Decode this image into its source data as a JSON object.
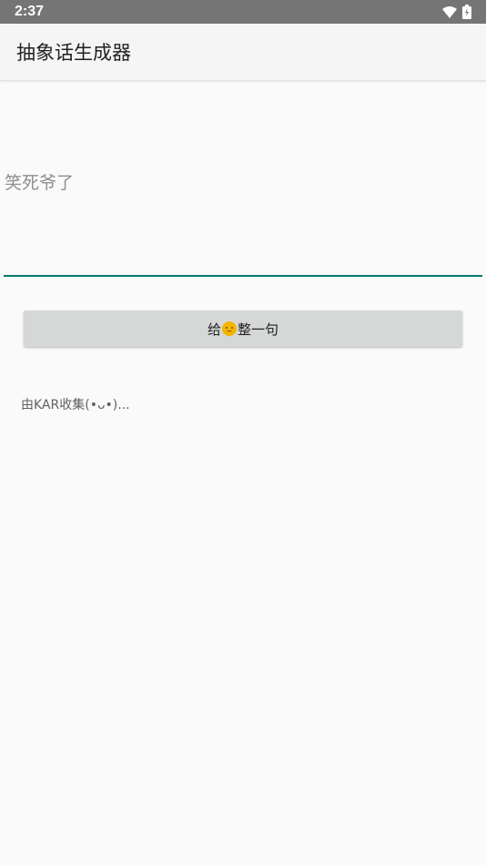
{
  "status_bar": {
    "time": "2:37",
    "icons": [
      "wifi-icon",
      "battery-icon"
    ]
  },
  "app_bar": {
    "title": "抽象话生成器"
  },
  "input": {
    "text": "笑死爷了",
    "underline_color": "#00796b"
  },
  "button": {
    "label_before": "给",
    "emoji_icon": "frowning-face-emoji",
    "label_after": "整一句"
  },
  "credit": {
    "text": "由KAR收集(•ᴗ•)..."
  },
  "colors": {
    "status_bar": "#757575",
    "app_bar": "#f5f5f5",
    "background": "#fafafa",
    "button": "#d6d7d7",
    "accent": "#00796b"
  }
}
